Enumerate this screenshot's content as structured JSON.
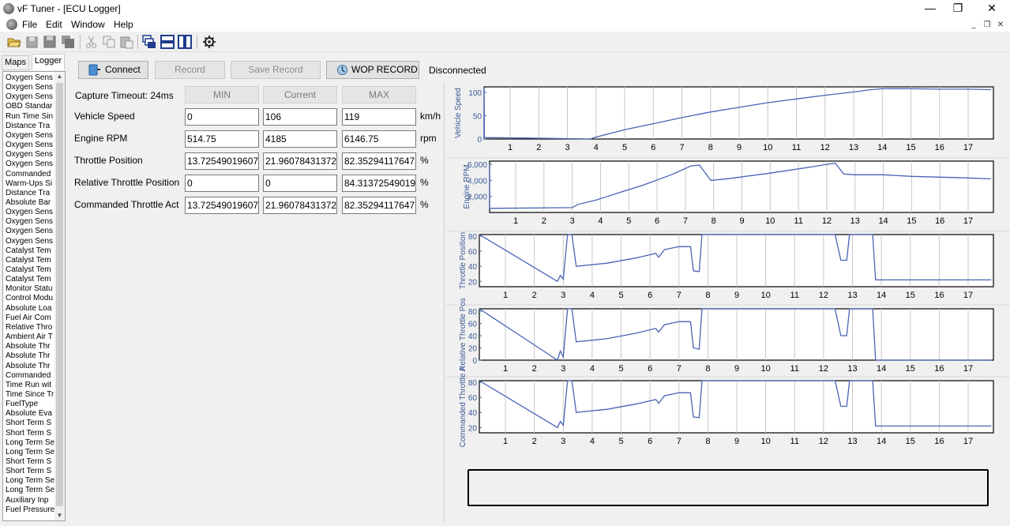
{
  "window": {
    "title": "vF Tuner - [ECU Logger]"
  },
  "menu": [
    "File",
    "Edit",
    "Window",
    "Help"
  ],
  "tabs": [
    "Maps",
    "Logger"
  ],
  "params": [
    "Oxygen Sens",
    "Oxygen Sens",
    "Oxygen Sens",
    "OBD Standar",
    "Run Time Sin",
    "Distance Tra",
    "Oxygen Sens",
    "Oxygen Sens",
    "Oxygen Sens",
    "Oxygen Sens",
    "Commanded",
    "Warm-Ups Si",
    "Distance Tra",
    "Absolute Bar",
    "Oxygen Sens",
    "Oxygen Sens",
    "Oxygen Sens",
    "Oxygen Sens",
    "Catalyst Tem",
    "Catalyst Tem",
    "Catalyst Tem",
    "Catalyst Tem",
    "Monitor Statu",
    "Control Modu",
    "Absolute Loa",
    "Fuel Air Com",
    "Relative Thro",
    "Ambient Air T",
    "Absolute Thr",
    "Absolute Thr",
    "Absolute Thr",
    "Commanded",
    "Time Run wit",
    "Time Since Tr",
    "FuelType",
    "Absolute Eva",
    "Short Term S",
    "Short Term S",
    "Long Term Se",
    "Long Term Se",
    "Short Term S",
    "Short Term S",
    "Long Term Se",
    "Long Term Se",
    "Auxiliary Inp",
    "Fuel Pressure"
  ],
  "buttons": {
    "connect": "Connect",
    "record": "Record",
    "save_record": "Save Record",
    "wop_record": "WOP RECORD"
  },
  "status": "Disconnected",
  "capture_timeout": "Capture Timeout: 24ms",
  "columns": [
    "MIN",
    "Current",
    "MAX"
  ],
  "rows": [
    {
      "label": "Vehicle Speed",
      "min": "0",
      "current": "106",
      "max": "119",
      "unit": "km/h"
    },
    {
      "label": "Engine RPM",
      "min": "514.75",
      "current": "4185",
      "max": "6146.75",
      "unit": "rpm"
    },
    {
      "label": "Throttle Position",
      "min": "13.72549019607",
      "current": "21.96078431372",
      "max": "82.35294117647",
      "unit": "%"
    },
    {
      "label": "Relative Throttle Position",
      "min": "0",
      "current": "0",
      "max": "84.31372549019",
      "unit": "%"
    },
    {
      "label": "Commanded Throttle Act",
      "min": "13.72549019607",
      "current": "21.96078431372",
      "max": "82.35294117647",
      "unit": "%"
    }
  ],
  "chart_data": [
    {
      "type": "line",
      "ylabel": "Vehicle Speed",
      "yticks": [
        "0",
        "50",
        "100"
      ],
      "ylim": [
        0,
        112
      ],
      "xticks": [
        "1",
        "2",
        "3",
        "4",
        "5",
        "6",
        "7",
        "8",
        "9",
        "10",
        "11",
        "12",
        "13",
        "14",
        "15",
        "16",
        "17"
      ],
      "x": [
        0,
        0.05,
        0.1,
        1.6,
        3.8,
        4.0,
        4.5,
        5.0,
        6.0,
        7.0,
        8.0,
        9.0,
        10.0,
        11.0,
        12.0,
        13.0,
        13.6,
        14.0,
        15.0,
        16.0,
        17.0,
        17.8
      ],
      "y": [
        0,
        110,
        3,
        2,
        0,
        4,
        12,
        20,
        33,
        46,
        58,
        68,
        78,
        86,
        94,
        101,
        106,
        108,
        108,
        107,
        107,
        106
      ]
    },
    {
      "type": "line",
      "ylabel": "Engine RPM",
      "yticks": [
        "2,000",
        "4,000",
        "6,000"
      ],
      "ylim": [
        0,
        6400
      ],
      "xticks": [
        "1",
        "2",
        "3",
        "4",
        "5",
        "6",
        "7",
        "8",
        "9",
        "10",
        "11",
        "12",
        "13",
        "14",
        "15",
        "16",
        "17"
      ],
      "x": [
        0,
        0.05,
        0.1,
        3.0,
        3.2,
        3.8,
        4.6,
        5.5,
        6.5,
        7.2,
        7.5,
        7.9,
        8.5,
        10.0,
        11.5,
        12.0,
        12.3,
        12.6,
        13.0,
        14.0,
        15.0,
        16.0,
        17.0,
        17.8
      ],
      "y": [
        6000,
        514,
        514,
        600,
        1000,
        1500,
        2400,
        3400,
        4700,
        5800,
        5900,
        4000,
        4200,
        4900,
        5700,
        6000,
        6146,
        4800,
        4700,
        4700,
        4500,
        4400,
        4300,
        4185
      ]
    },
    {
      "type": "line",
      "ylabel": "Throttle Position",
      "yticks": [
        "20",
        "40",
        "60",
        "80"
      ],
      "ylim": [
        13,
        82
      ],
      "xticks": [
        "1",
        "2",
        "3",
        "4",
        "5",
        "6",
        "7",
        "8",
        "9",
        "10",
        "11",
        "12",
        "13",
        "14",
        "15",
        "16",
        "17"
      ],
      "x": [
        0,
        0.05,
        0.1,
        2.8,
        2.9,
        3.0,
        3.15,
        3.3,
        3.45,
        4.5,
        5.5,
        6.2,
        6.3,
        6.5,
        7.0,
        7.4,
        7.5,
        7.7,
        7.8,
        12.4,
        12.6,
        12.8,
        12.9,
        13.7,
        13.8,
        14.0,
        17.0,
        17.8
      ],
      "y": [
        82,
        82,
        82,
        20,
        28,
        23,
        82,
        82,
        40,
        44,
        51,
        57,
        52,
        62,
        66,
        66,
        34,
        33,
        82,
        82,
        48,
        48,
        82,
        82,
        22,
        22,
        22,
        22
      ]
    },
    {
      "type": "line",
      "ylabel": "Relative Throttle Pos",
      "yticks": [
        "0",
        "20",
        "40",
        "60",
        "80"
      ],
      "ylim": [
        0,
        84
      ],
      "xticks": [
        "1",
        "2",
        "3",
        "4",
        "5",
        "6",
        "7",
        "8",
        "9",
        "10",
        "11",
        "12",
        "13",
        "14",
        "15",
        "16",
        "17"
      ],
      "x": [
        0,
        0.05,
        0.1,
        2.8,
        2.9,
        3.0,
        3.15,
        3.3,
        3.45,
        4.5,
        5.5,
        6.2,
        6.3,
        6.5,
        7.0,
        7.4,
        7.5,
        7.7,
        7.8,
        12.4,
        12.6,
        12.8,
        12.9,
        13.7,
        13.8,
        14.0,
        17.0,
        17.8
      ],
      "y": [
        84,
        84,
        84,
        0,
        15,
        5,
        84,
        84,
        30,
        35,
        44,
        52,
        46,
        58,
        63,
        63,
        20,
        18,
        84,
        84,
        40,
        40,
        84,
        84,
        0,
        0,
        0,
        0
      ]
    },
    {
      "type": "line",
      "ylabel": "Commanded Throttle A",
      "yticks": [
        "20",
        "40",
        "60",
        "80"
      ],
      "ylim": [
        13,
        82
      ],
      "xticks": [
        "1",
        "2",
        "3",
        "4",
        "5",
        "6",
        "7",
        "8",
        "9",
        "10",
        "11",
        "12",
        "13",
        "14",
        "15",
        "16",
        "17"
      ],
      "x": [
        0,
        0.05,
        0.1,
        2.8,
        2.9,
        3.0,
        3.15,
        3.3,
        3.45,
        4.5,
        5.5,
        6.2,
        6.3,
        6.5,
        7.0,
        7.4,
        7.5,
        7.7,
        7.8,
        12.4,
        12.6,
        12.8,
        12.9,
        13.7,
        13.8,
        14.0,
        17.0,
        17.8
      ],
      "y": [
        82,
        82,
        82,
        20,
        28,
        23,
        82,
        82,
        40,
        44,
        51,
        57,
        52,
        62,
        66,
        66,
        34,
        33,
        82,
        82,
        48,
        48,
        82,
        82,
        22,
        22,
        22,
        22
      ]
    }
  ]
}
